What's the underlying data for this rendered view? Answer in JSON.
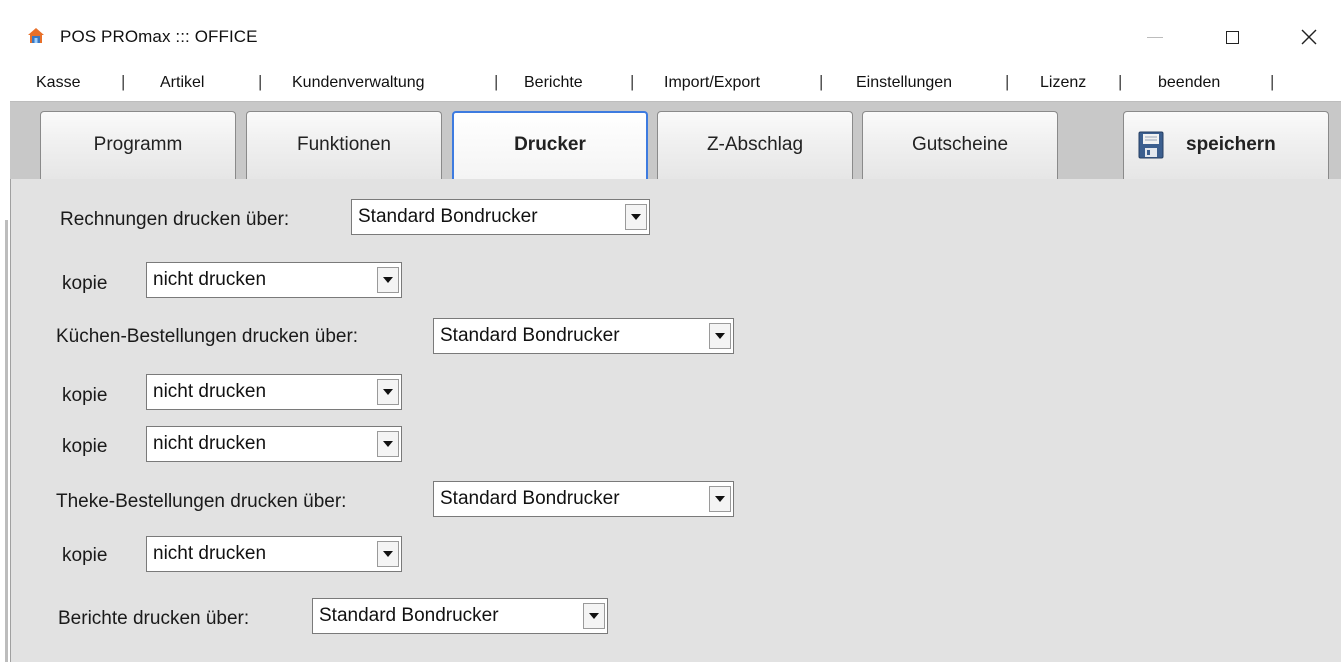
{
  "window": {
    "title": "POS PROmax ::: OFFICE",
    "controls": {
      "minimize": "minimize-icon",
      "maximize": "maximize-icon",
      "close": "close-icon"
    }
  },
  "menu": {
    "items": [
      "Kasse",
      "Artikel",
      "Kundenverwaltung",
      "Berichte",
      "Import/Export",
      "Einstellungen",
      "Lizenz",
      "beenden"
    ],
    "separator": "|"
  },
  "tabs": {
    "programm": "Programm",
    "funktionen": "Funktionen",
    "drucker": "Drucker",
    "zabschlag": "Z-Abschlag",
    "gutscheine": "Gutscheine",
    "speichern": "speichern",
    "active": "Drucker"
  },
  "form": {
    "rechnungen": {
      "label": "Rechnungen drucken über:",
      "value": "Standard Bondrucker"
    },
    "rechnungen_kopie": {
      "label": "kopie",
      "value": "nicht drucken"
    },
    "kuechen": {
      "label": "Küchen-Bestellungen drucken über:",
      "value": "Standard Bondrucker"
    },
    "kuechen_kopie1": {
      "label": "kopie",
      "value": "nicht drucken"
    },
    "kuechen_kopie2": {
      "label": "kopie",
      "value": "nicht drucken"
    },
    "theke": {
      "label": "Theke-Bestellungen drucken über:",
      "value": "Standard Bondrucker"
    },
    "theke_kopie": {
      "label": "kopie",
      "value": "nicht drucken"
    },
    "berichte": {
      "label": "Berichte drucken über:",
      "value": "Standard Bondrucker"
    }
  },
  "colors": {
    "active_tab_border": "#3d7be0",
    "panel_bg": "#e2e2e2",
    "tabstrip_bg": "#c8c8c8"
  }
}
